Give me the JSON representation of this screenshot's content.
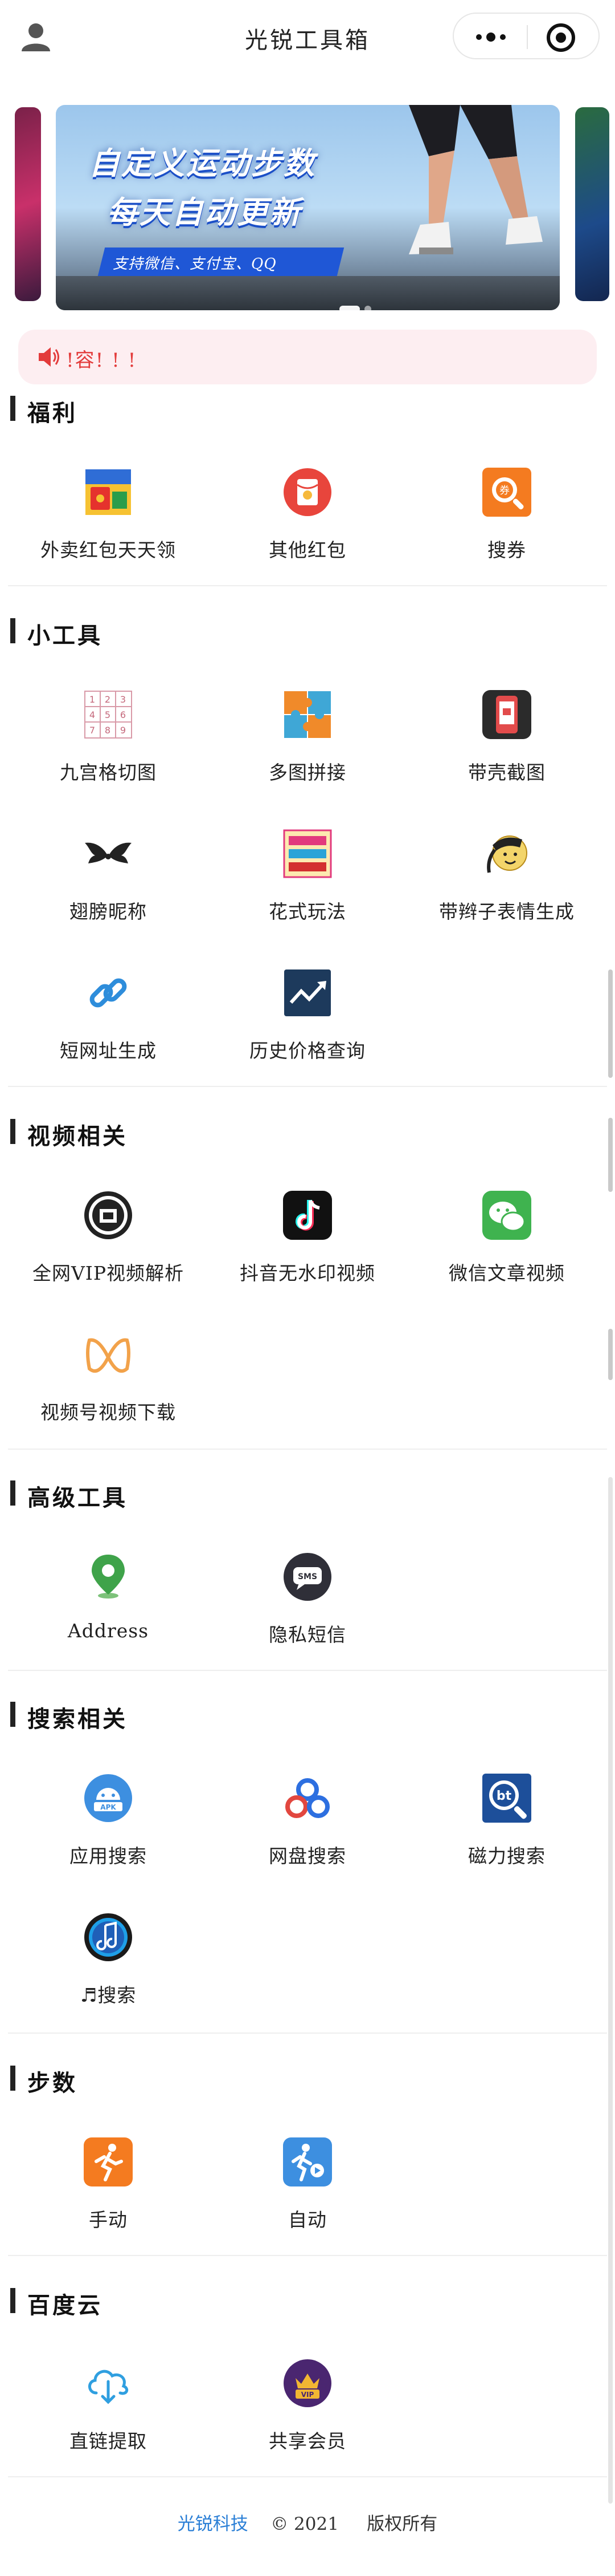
{
  "header": {
    "title": "光锐工具箱"
  },
  "carousel": {
    "banner_line1": "自定义运动步数",
    "banner_line2": "每天自动更新",
    "banner_tag": "支持微信、支付宝、QQ"
  },
  "notice": {
    "text": "!容! ! !"
  },
  "sections": [
    {
      "title": "福利",
      "items": [
        {
          "label": "外卖红包天天领",
          "icon": "food-coupon-icon"
        },
        {
          "label": "其他红包",
          "icon": "red-envelope-icon"
        },
        {
          "label": "搜券",
          "icon": "coupon-search-icon"
        }
      ]
    },
    {
      "title": "小工具",
      "items": [
        {
          "label": "九宫格切图",
          "icon": "nine-grid-icon"
        },
        {
          "label": "多图拼接",
          "icon": "puzzle-icon"
        },
        {
          "label": "带壳截图",
          "icon": "phone-frame-icon"
        },
        {
          "label": "翅膀昵称",
          "icon": "wings-icon"
        },
        {
          "label": "花式玩法",
          "icon": "fancy-text-icon"
        },
        {
          "label": "带辫子表情生成",
          "icon": "braid-emoji-icon"
        },
        {
          "label": "短网址生成",
          "icon": "link-icon"
        },
        {
          "label": "历史价格查询",
          "icon": "price-chart-icon"
        }
      ]
    },
    {
      "title": "视频相关",
      "items": [
        {
          "label": "全网VIP视频解析",
          "icon": "vip-seal-icon"
        },
        {
          "label": "抖音无水印视频",
          "icon": "tiktok-icon"
        },
        {
          "label": "微信文章视频",
          "icon": "wechat-icon"
        },
        {
          "label": "视频号视频下载",
          "icon": "channels-icon"
        }
      ]
    },
    {
      "title": "高级工具",
      "items": [
        {
          "label": "Address",
          "icon": "map-pin-icon"
        },
        {
          "label": "隐私短信",
          "icon": "sms-icon"
        }
      ]
    },
    {
      "title": "搜索相关",
      "items": [
        {
          "label": "应用搜索",
          "icon": "apk-icon"
        },
        {
          "label": "网盘搜索",
          "icon": "cloud-disk-icon"
        },
        {
          "label": "磁力搜索",
          "icon": "bt-search-icon"
        },
        {
          "label": "♬搜索",
          "icon": "music-icon"
        }
      ]
    },
    {
      "title": "步数",
      "items": [
        {
          "label": "手动",
          "icon": "run-manual-icon"
        },
        {
          "label": "自动",
          "icon": "run-auto-icon"
        }
      ]
    },
    {
      "title": "百度云",
      "items": [
        {
          "label": "直链提取",
          "icon": "cloud-download-icon"
        },
        {
          "label": "共享会员",
          "icon": "vip-crown-icon"
        }
      ]
    }
  ],
  "footer": {
    "brand": "光锐科技",
    "copyright": "© 2021",
    "rights": "版权所有"
  }
}
